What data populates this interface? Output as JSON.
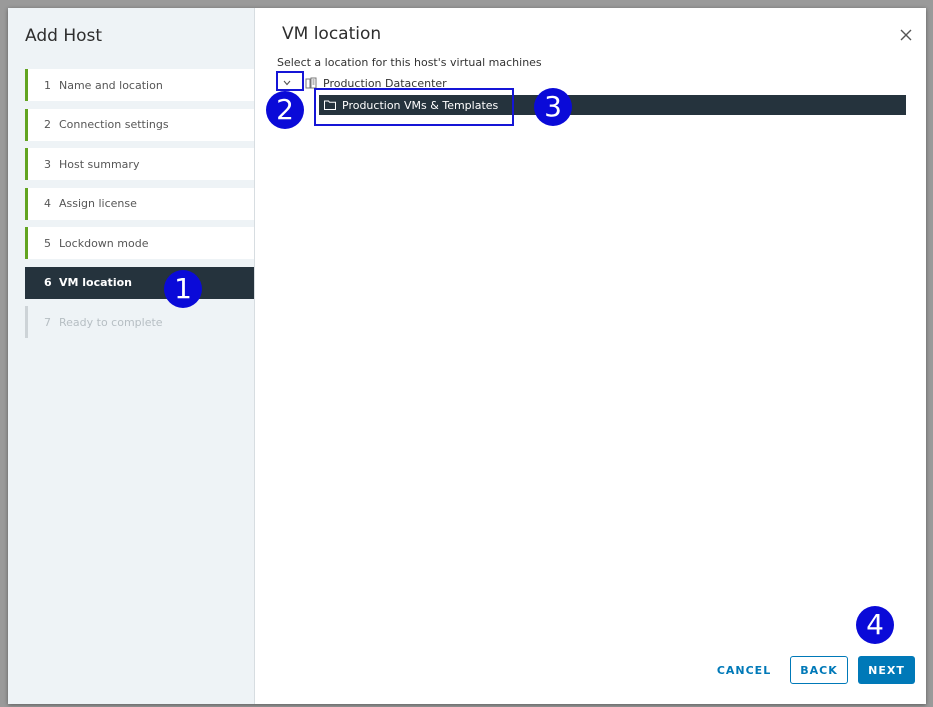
{
  "wizard": {
    "title": "Add Host",
    "steps": [
      {
        "num": "1",
        "label": "Name and location",
        "state": "done"
      },
      {
        "num": "2",
        "label": "Connection settings",
        "state": "done"
      },
      {
        "num": "3",
        "label": "Host summary",
        "state": "done"
      },
      {
        "num": "4",
        "label": "Assign license",
        "state": "done"
      },
      {
        "num": "5",
        "label": "Lockdown mode",
        "state": "done"
      },
      {
        "num": "6",
        "label": "VM location",
        "state": "active"
      },
      {
        "num": "7",
        "label": "Ready to complete",
        "state": "disabled"
      }
    ]
  },
  "page": {
    "title": "VM location",
    "instruction": "Select a location for this host's virtual machines",
    "close_icon": "close-icon"
  },
  "tree": {
    "datacenter": {
      "label": "Production Datacenter",
      "icon": "datacenter-icon",
      "expanded": true
    },
    "folder": {
      "label": "Production VMs & Templates",
      "icon": "folder-icon",
      "selected": true
    }
  },
  "annotations": [
    "1",
    "2",
    "3",
    "4"
  ],
  "footer": {
    "cancel": "CANCEL",
    "back": "BACK",
    "next": "NEXT"
  },
  "colors": {
    "accent": "#0079b8",
    "selected_bg": "#25333d",
    "step_done_bar": "#62a420",
    "annotation": "#0a0ad8"
  }
}
